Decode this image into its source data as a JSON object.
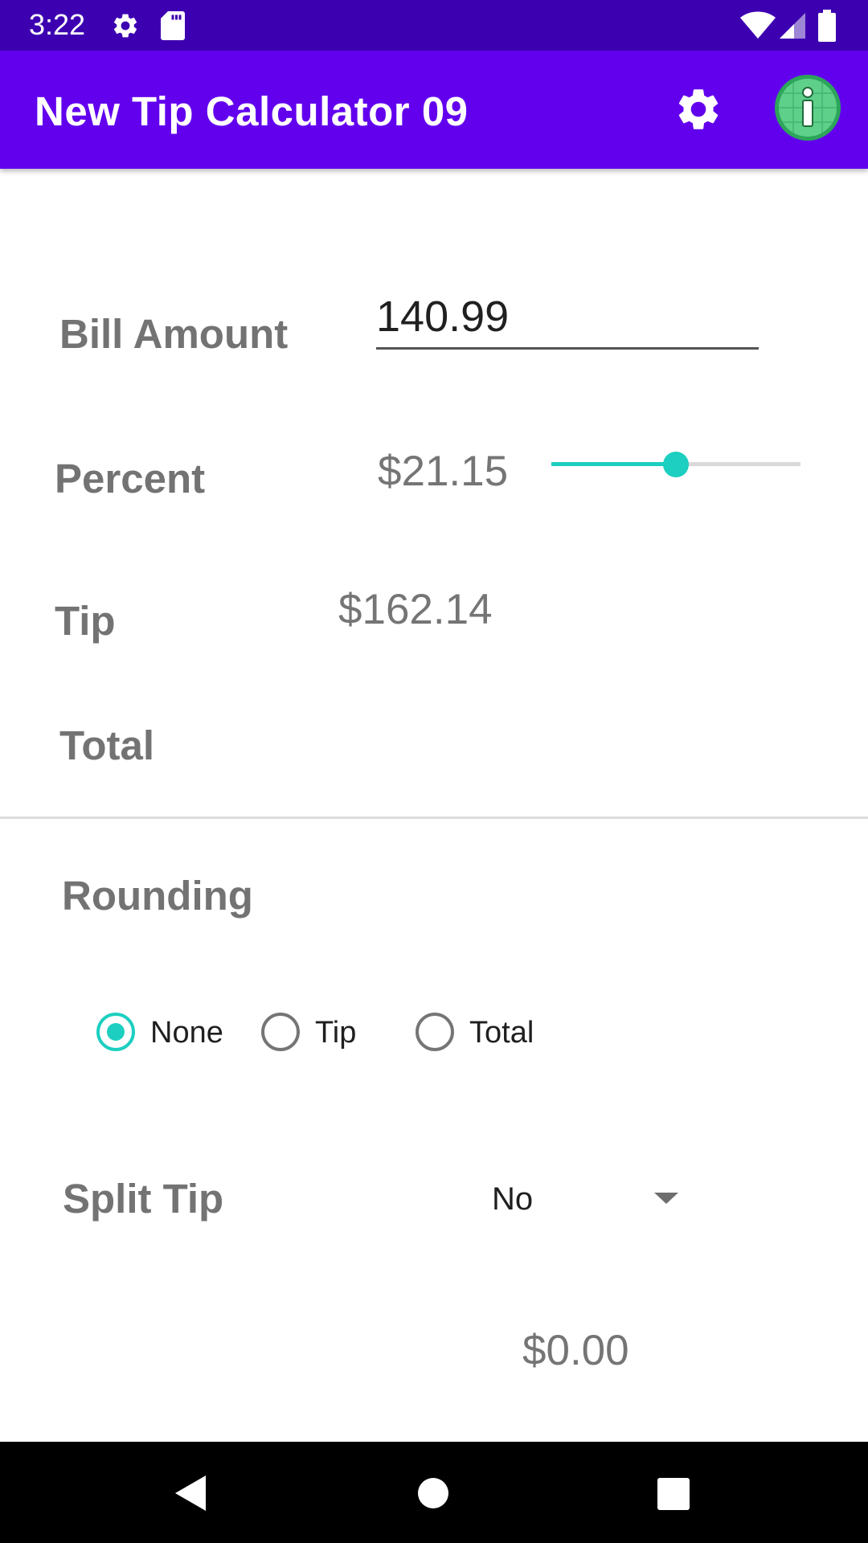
{
  "status_bar": {
    "time": "3:22",
    "icons": [
      "gear-icon",
      "sd-card-icon",
      "wifi-icon",
      "signal-icon",
      "battery-icon"
    ]
  },
  "app_bar": {
    "title": "New Tip Calculator 09",
    "settings_icon": "gear-icon",
    "info_icon": "info-icon",
    "color": "#6200ee"
  },
  "form": {
    "bill_amount_label": "Bill Amount",
    "bill_amount_value": "140.99",
    "percent_label": "Percent",
    "percent_value": "$21.15",
    "percent_slider": 0.5,
    "tip_label": "Tip",
    "tip_value": "$162.14",
    "total_label": "Total"
  },
  "rounding": {
    "label": "Rounding",
    "options": [
      "None",
      "Tip",
      "Total"
    ],
    "selected": "None"
  },
  "split_tip": {
    "label": "Split Tip",
    "selected": "No",
    "value": "$0.00"
  },
  "nav_bar": {
    "icons": [
      "back-icon",
      "home-icon",
      "recents-icon"
    ]
  },
  "accent_color": "#1ccfc0"
}
